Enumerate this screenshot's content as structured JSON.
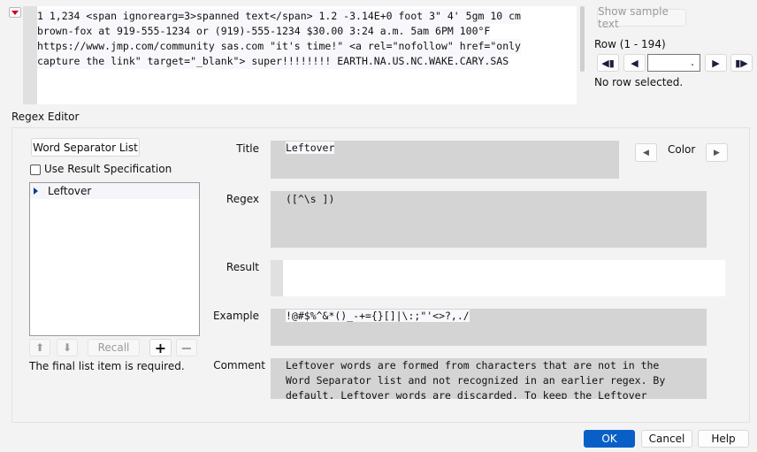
{
  "sample": {
    "lines": [
      "1 1,234 <span ignorearg=3>spanned text</span> 1.2 -3.14E+0 foot 3\" 4' 5gm 10 cm",
      "brown-fox at 919-555-1234 or (919)-555-1234 $30.00 3:24 a.m. 5am 6PM 100°F",
      "https://www.jmp.com/community sas.com  \"it's time!\" <a rel=\"nofollow\" href=\"only",
      "capture the link\" target=\"_blank\"> super!!!!!!!! EARTH.NA.US.NC.WAKE.CARY.SAS"
    ],
    "show_sample_button": "Show sample text"
  },
  "row_nav": {
    "label": "Row (1 - 194)",
    "input_value": ".",
    "status": "No row selected."
  },
  "editor": {
    "heading": "Regex Editor",
    "word_separator_button": "Word Separator List",
    "use_result_spec_label": "Use Result Specification",
    "use_result_spec_checked": false,
    "list_items": [
      "Leftover"
    ],
    "recall_button": "Recall",
    "required_note": "The final list item is required.",
    "labels": {
      "title": "Title",
      "regex": "Regex",
      "result": "Result",
      "example": "Example",
      "comment": "Comment",
      "color": "Color"
    },
    "values": {
      "title": "Leftover",
      "regex": "([^\\s ])",
      "result": "",
      "example": "!@#$%^&*()_-+={}[]|\\:;\"'<>?,./",
      "comment": [
        "Leftover words are formed from characters that are not in the",
        "Word Separator list and not recognized in an earlier regex. By",
        "default, Leftover words are discarded. To keep the Leftover"
      ]
    }
  },
  "footer": {
    "ok": "OK",
    "cancel": "Cancel",
    "help": "Help"
  },
  "colors": {
    "accent": "#0a5fc7",
    "menu_red": "#d0021b",
    "field_gray": "#d4d4d4"
  }
}
